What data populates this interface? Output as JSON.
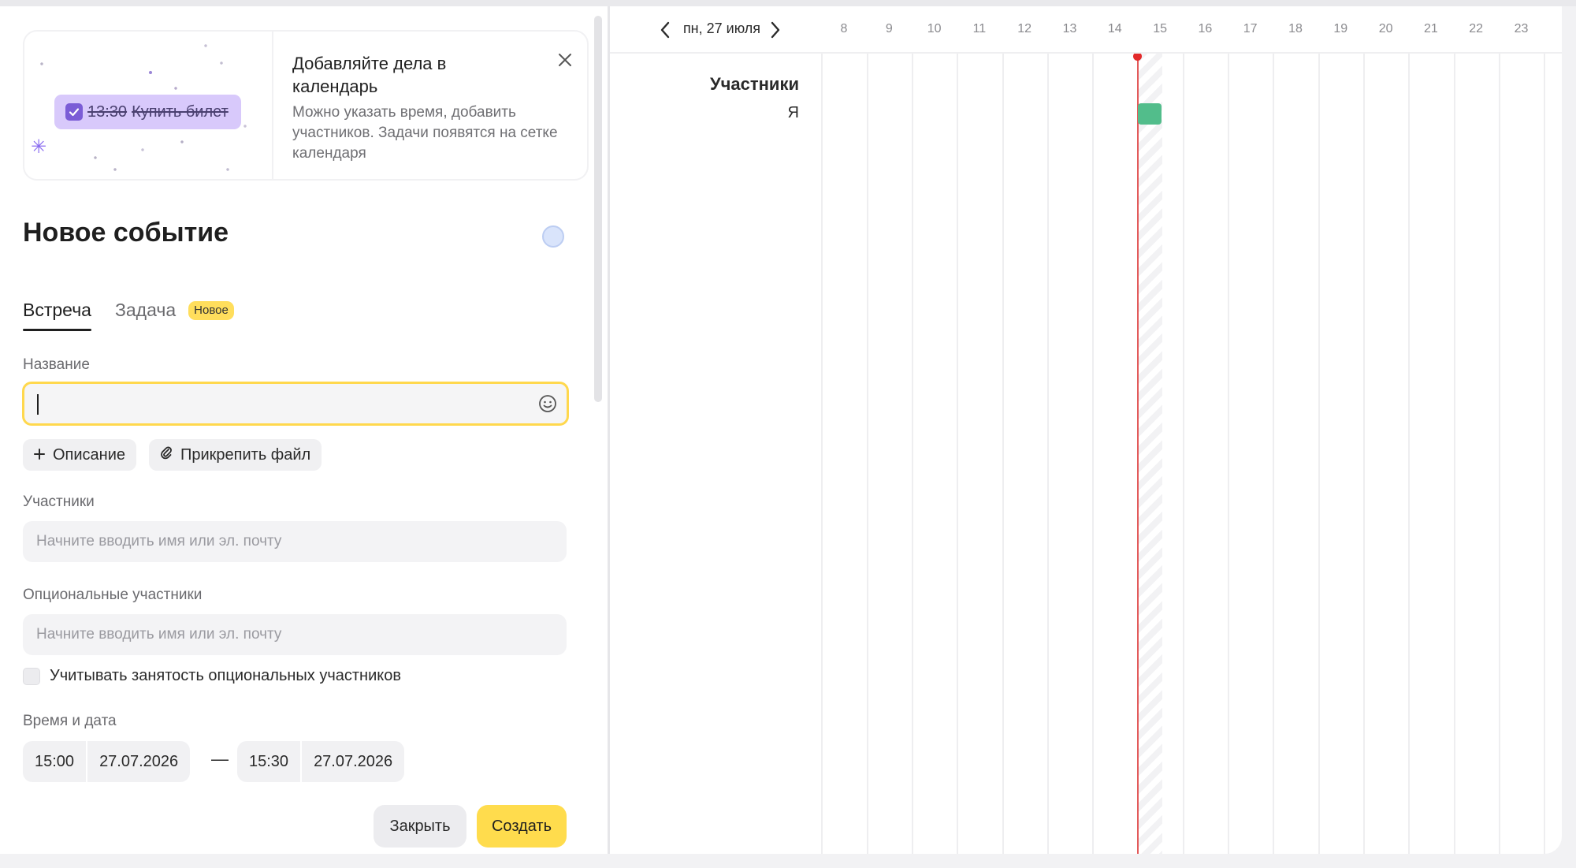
{
  "promo": {
    "chip_time": "13:30",
    "chip_text": "Купить билет",
    "title": "Добавляйте дела в календарь",
    "text": "Можно указать время, добавить участников. Задачи появятся на сетке календаря"
  },
  "form": {
    "title": "Новое событие",
    "tabs": [
      {
        "label": "Встреча"
      },
      {
        "label": "Задача",
        "badge": "Новое"
      }
    ],
    "name_label": "Название",
    "name_value": "",
    "description_button": "Описание",
    "attach_button": "Прикрепить файл",
    "participants_label": "Участники",
    "participants_placeholder": "Начните вводить имя или эл. почту",
    "optional_label": "Опциональные участники",
    "optional_placeholder": "Начните вводить имя или эл. почту",
    "consider_optional": "Учитывать занятость опциональных участников",
    "datetime_label": "Время и дата",
    "start_time": "15:00",
    "start_date": "27.07.2026",
    "end_time": "15:30",
    "end_date": "27.07.2026",
    "dash": "—",
    "close_button": "Закрыть",
    "create_button": "Создать"
  },
  "timeline": {
    "date": "пн, 27 июля",
    "hours": [
      "8",
      "9",
      "10",
      "11",
      "12",
      "13",
      "14",
      "15",
      "16",
      "17",
      "18",
      "19",
      "20",
      "21",
      "22",
      "23"
    ],
    "participants_title": "Участники",
    "me": "Я",
    "event_color": "#52bd8b",
    "now_color": "#e32a2a"
  },
  "colors": {
    "accent": "#ffdc4d",
    "focus_border": "#ffd84d",
    "promo_chip": "#d8c9fb"
  }
}
